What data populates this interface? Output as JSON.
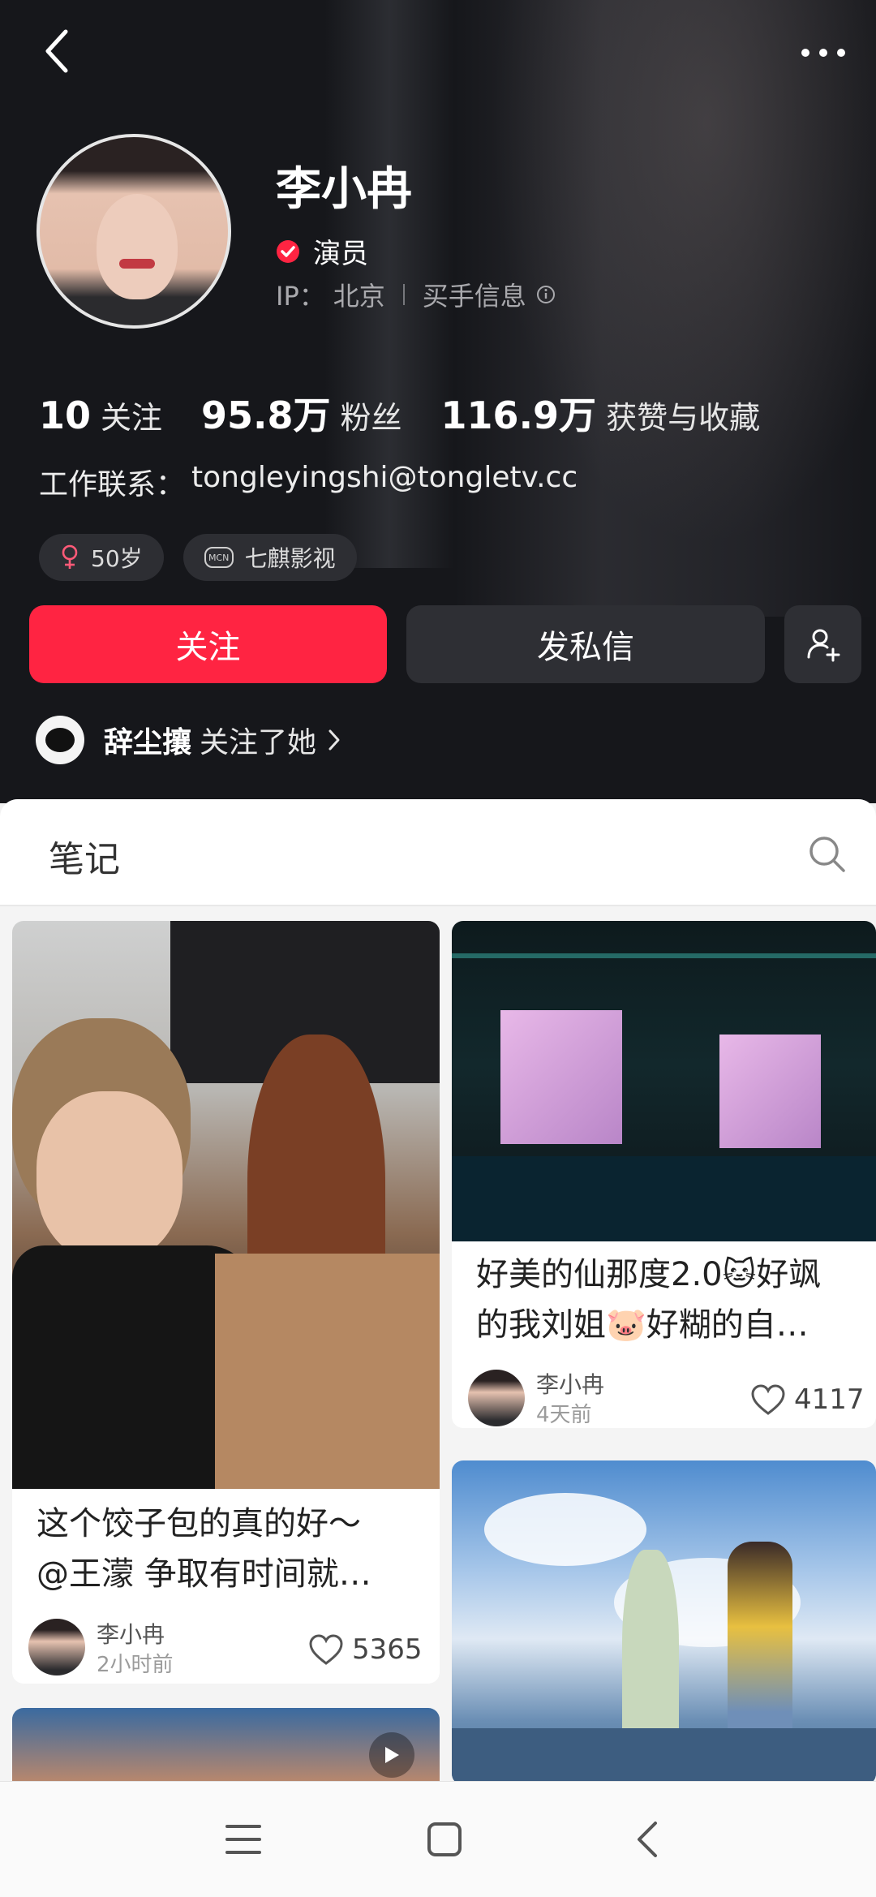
{
  "profile": {
    "name": "李小冉",
    "verified_label": "演员",
    "ip_label": "IP：",
    "ip_value": "北京",
    "buyer_info": "买手信息",
    "contact_label": "工作联系：",
    "contact_value": "tongleyingshi@tongletv.cc",
    "stats": [
      {
        "num": "10",
        "label": "关注"
      },
      {
        "num": "95.8万",
        "label": "粉丝"
      },
      {
        "num": "116.9万",
        "label": "获赞与收藏"
      }
    ],
    "tags": [
      {
        "icon": "female-icon",
        "label": "50岁"
      },
      {
        "icon": "mcn-icon",
        "mcn_text": "MCN",
        "label": "七麒影视"
      }
    ],
    "follow_label": "关注",
    "message_label": "发私信",
    "mutual_name": "辞尘攘",
    "mutual_text": "关注了她",
    "accent_color": "#ff2442",
    "verified_color": "#ff2442"
  },
  "notes_tab": {
    "label": "笔记"
  },
  "cards": [
    {
      "title_line1": "这个饺子包的真的好～",
      "title_line2": "@王濛 争取有时间就…",
      "author": "李小冉",
      "time": "2小时前",
      "likes": "5365"
    },
    {
      "title_line1": "好美的仙那度2.0🐱好飒",
      "title_line2": "的我刘姐🐷好糊的自…",
      "author": "李小冉",
      "time": "4天前",
      "likes": "4117"
    }
  ]
}
